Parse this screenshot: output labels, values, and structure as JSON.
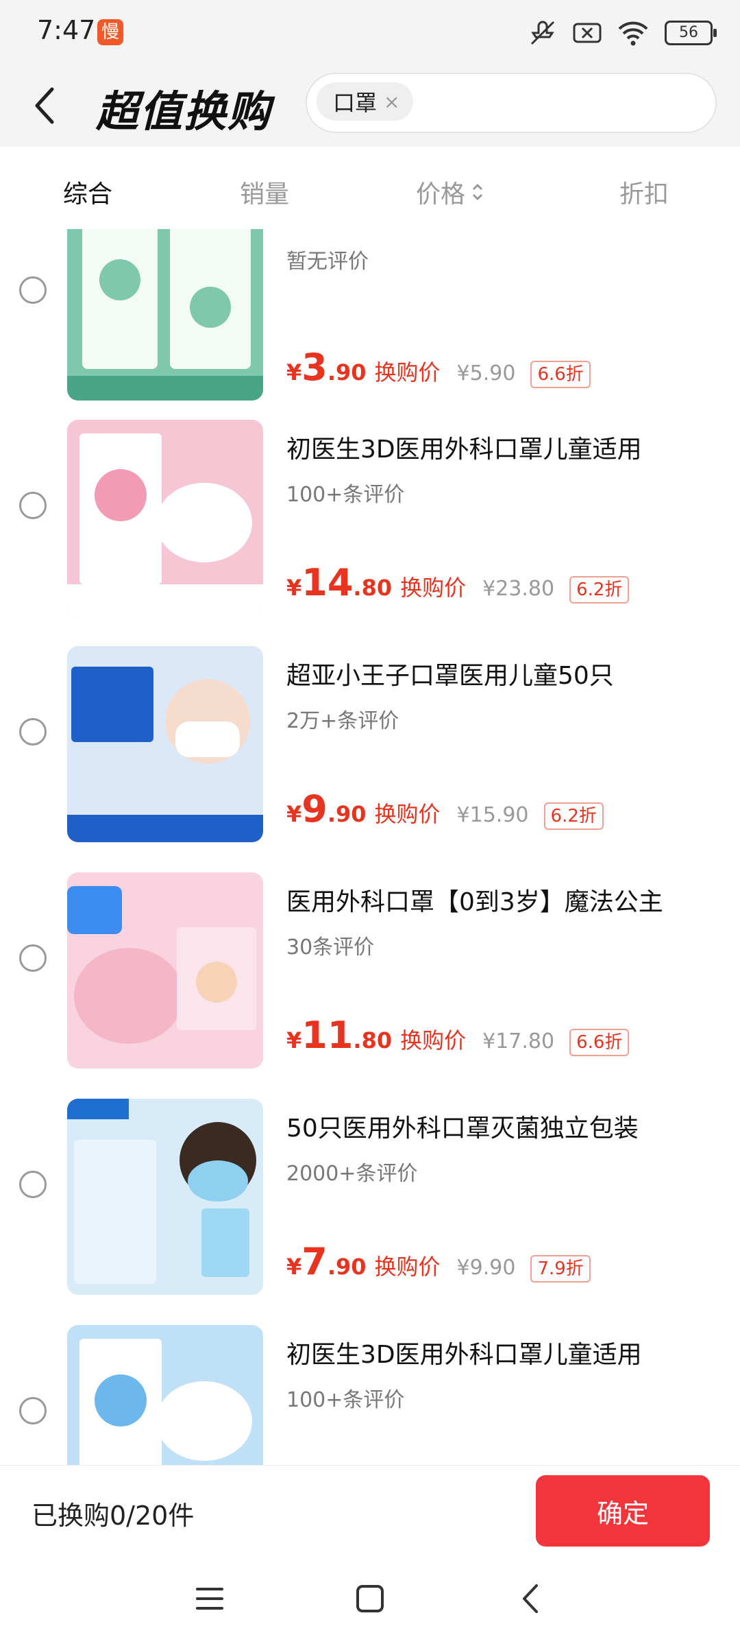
{
  "status_bar": {
    "time": "7:47",
    "app_badge": "慢",
    "battery": "56",
    "icons": [
      "mute-icon",
      "sim-off-icon",
      "wifi-icon",
      "battery-icon"
    ]
  },
  "header": {
    "title": "超值换购",
    "search_chip": "口罩",
    "chip_close": "×"
  },
  "sort_tabs": [
    {
      "label": "综合",
      "active": true
    },
    {
      "label": "销量",
      "active": false
    },
    {
      "label": "价格",
      "active": false,
      "icon": "sort-updown-icon"
    },
    {
      "label": "折扣",
      "active": false
    }
  ],
  "products": [
    {
      "name": "",
      "reviews": "暂无评价",
      "price_int": "3",
      "price_dec": ".90",
      "price_label": "换购价",
      "orig_price": "¥5.90",
      "discount": "6.6折",
      "thumb_bg": "#7fc8ae"
    },
    {
      "name": "初医生3D医用外科口罩儿童适用",
      "reviews": "100+条评价",
      "price_int": "14",
      "price_dec": ".80",
      "price_label": "换购价",
      "orig_price": "¥23.80",
      "discount": "6.2折",
      "thumb_bg": "#f7c6d4"
    },
    {
      "name": "超亚小王子口罩医用儿童50只",
      "reviews": "2万+条评价",
      "price_int": "9",
      "price_dec": ".90",
      "price_label": "换购价",
      "orig_price": "¥15.90",
      "discount": "6.2折",
      "thumb_bg": "#dbe8f8"
    },
    {
      "name": "医用外科口罩【0到3岁】魔法公主",
      "reviews": "30条评价",
      "price_int": "11",
      "price_dec": ".80",
      "price_label": "换购价",
      "orig_price": "¥17.80",
      "discount": "6.6折",
      "thumb_bg": "#f9d3df"
    },
    {
      "name": "50只医用外科口罩灭菌独立包装",
      "reviews": "2000+条评价",
      "price_int": "7",
      "price_dec": ".90",
      "price_label": "换购价",
      "orig_price": "¥9.90",
      "discount": "7.9折",
      "thumb_bg": "#d8ebf8"
    },
    {
      "name": "初医生3D医用外科口罩儿童适用",
      "reviews": "100+条评价",
      "price_int": "",
      "price_dec": "",
      "price_label": "",
      "orig_price": "",
      "discount": "",
      "thumb_bg": "#bfe0f6"
    }
  ],
  "currency": "¥",
  "bottom_bar": {
    "counter": "已换购0/20件",
    "confirm": "确定"
  },
  "colors": {
    "accent": "#e8331e",
    "confirm_bg": "#f2353b"
  }
}
